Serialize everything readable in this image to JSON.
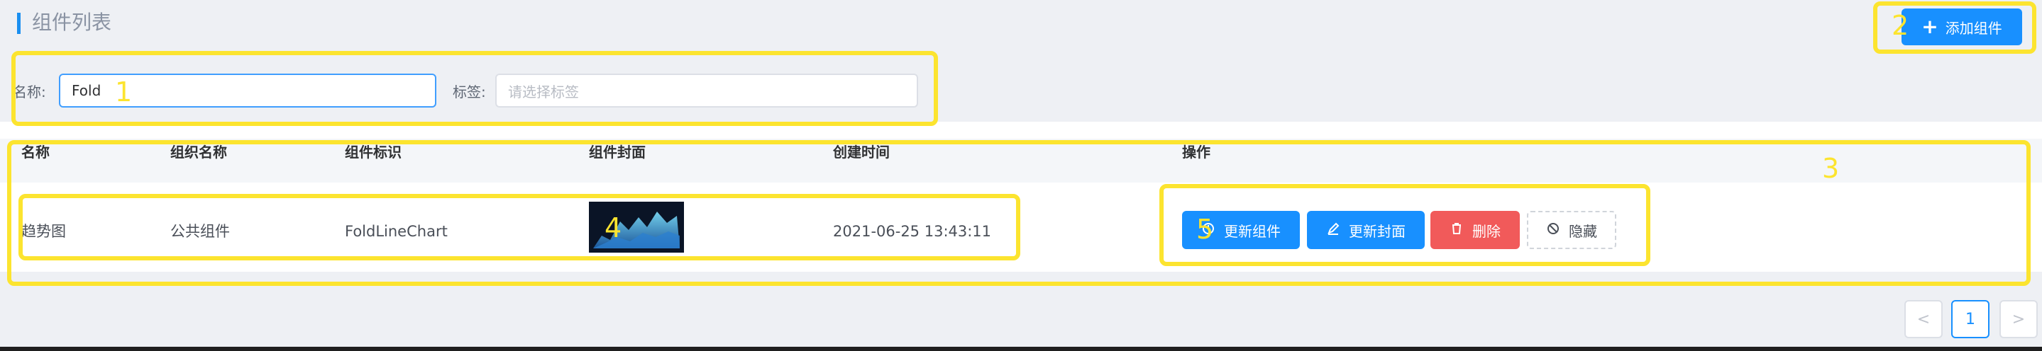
{
  "header": {
    "title": "组件列表",
    "add_label": "添加组件"
  },
  "filter": {
    "name_label": "名称:",
    "name_value": "Fold",
    "tag_label": "标签:",
    "tag_placeholder": "请选择标签"
  },
  "table": {
    "columns": [
      "名称",
      "组织名称",
      "组件标识",
      "组件封面",
      "创建时间",
      "操作"
    ],
    "rows": [
      {
        "name": "趋势图",
        "org": "公共组件",
        "key": "FoldLineChart",
        "created": "2021-06-25 13:43:11"
      }
    ]
  },
  "actions": {
    "update": "更新组件",
    "update_cover": "更新封面",
    "delete": "删除",
    "hide": "隐藏"
  },
  "pagination": {
    "prev": "<",
    "current": "1",
    "next": ">"
  },
  "annotations": [
    "1",
    "2",
    "3",
    "4",
    "5",
    "3"
  ],
  "colors": {
    "primary": "#1890ff",
    "danger": "#f15a5a",
    "annotation": "#fce42f"
  }
}
